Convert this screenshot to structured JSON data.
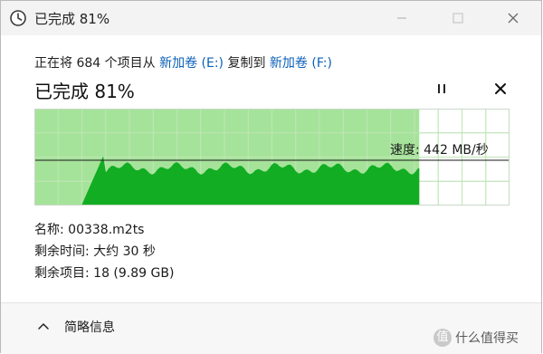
{
  "window": {
    "title": "已完成 81%"
  },
  "transfer": {
    "copy_prefix": "正在将 684 个项目从 ",
    "source": "新加卷 (E:)",
    "copy_middle": " 复制到 ",
    "destination": "新加卷 (F:)",
    "percent_heading": "已完成 81%",
    "progress_fraction": 0.81,
    "speed_label": "速度: 442 MB/秒"
  },
  "details": {
    "name": "名称: 00338.m2ts",
    "time_remaining": "剩余时间: 大约 30 秒",
    "items_remaining": "剩余项目: 18 (9.89 GB)"
  },
  "footer": {
    "toggle_label": "简略信息"
  },
  "watermark": {
    "logo_char": "值",
    "text": "什么值得买"
  },
  "colors": {
    "progress_fill": "#a6e39a",
    "speed_area": "#12ad23",
    "link": "#0b5fb8",
    "grid": "#cfe3cf"
  },
  "icons": {
    "app": "clock-icon",
    "pause": "pause-icon",
    "cancel": "close-icon",
    "toggle": "chevron-up-icon"
  }
}
